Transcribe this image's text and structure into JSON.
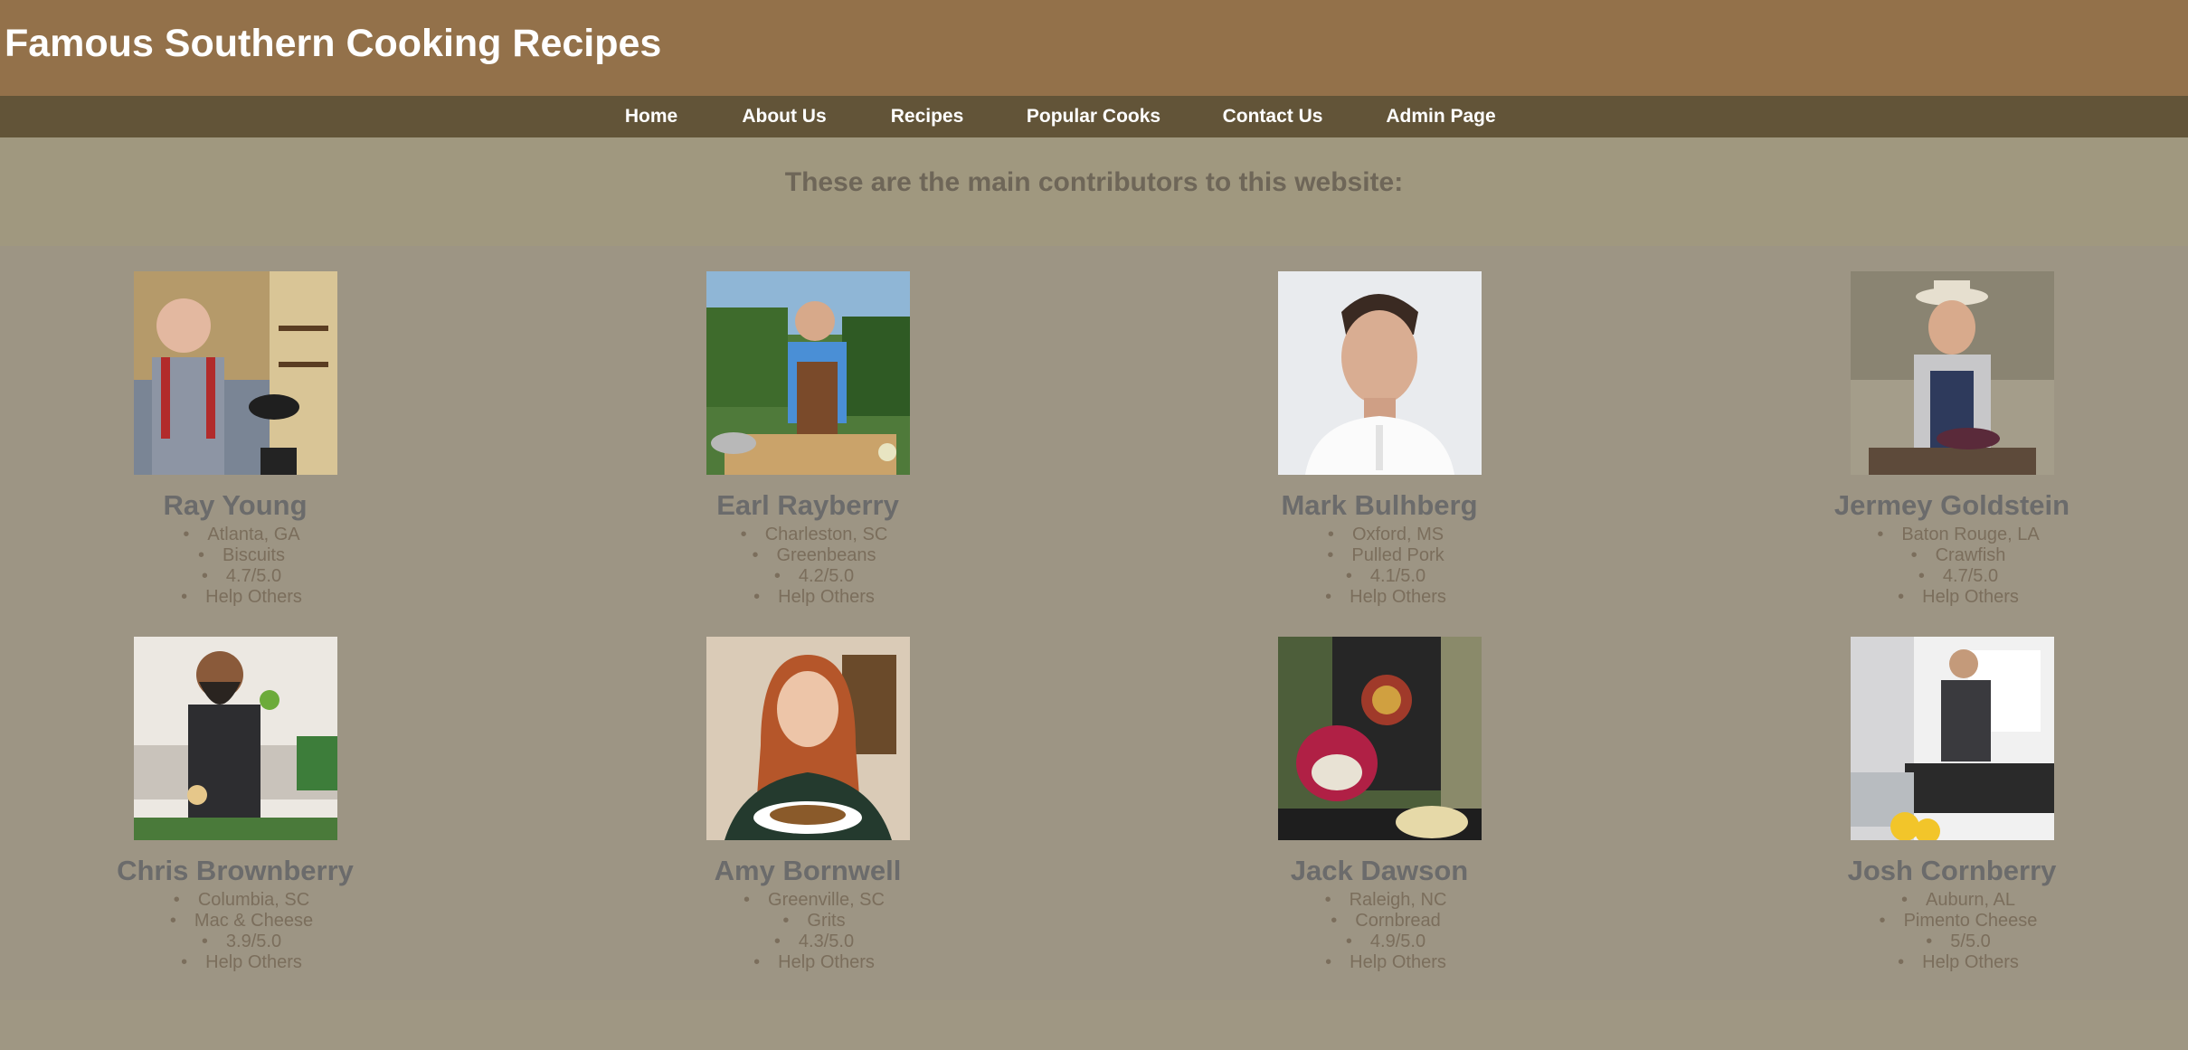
{
  "header": {
    "title": "Famous Southern Cooking Recipes"
  },
  "nav": {
    "items": [
      {
        "label": "Home"
      },
      {
        "label": "About Us"
      },
      {
        "label": "Recipes"
      },
      {
        "label": "Popular Cooks"
      },
      {
        "label": "Contact Us"
      },
      {
        "label": "Admin Page"
      }
    ]
  },
  "intro": {
    "heading": "These are the main contributors to this website:"
  },
  "cooks": [
    {
      "name": "Ray Young",
      "location": "Atlanta, GA",
      "dish": "Biscuits",
      "rating": "4.7/5.0",
      "help": "Help Others"
    },
    {
      "name": "Earl Rayberry",
      "location": "Charleston, SC",
      "dish": "Greenbeans",
      "rating": "4.2/5.0",
      "help": "Help Others"
    },
    {
      "name": "Mark Bulhberg",
      "location": "Oxford, MS",
      "dish": "Pulled Pork",
      "rating": "4.1/5.0",
      "help": "Help Others"
    },
    {
      "name": "Jermey Goldstein",
      "location": "Baton Rouge, LA",
      "dish": "Crawfish",
      "rating": "4.7/5.0",
      "help": "Help Others"
    },
    {
      "name": "Chris Brownberry",
      "location": "Columbia, SC",
      "dish": "Mac & Cheese",
      "rating": "3.9/5.0",
      "help": "Help Others"
    },
    {
      "name": "Amy Bornwell",
      "location": "Greenville, SC",
      "dish": "Grits",
      "rating": "4.3/5.0",
      "help": "Help Others"
    },
    {
      "name": "Jack Dawson",
      "location": "Raleigh, NC",
      "dish": "Cornbread",
      "rating": "4.9/5.0",
      "help": "Help Others"
    },
    {
      "name": "Josh Cornberry",
      "location": "Auburn, AL",
      "dish": "Pimento Cheese",
      "rating": "5/5.0",
      "help": "Help Others"
    }
  ],
  "colors": {
    "header_bg": "#93714a",
    "nav_bg": "#625438",
    "page_bg": "#9f9783",
    "name_text": "#6b6b6b",
    "detail_text": "#7b6e5c"
  }
}
